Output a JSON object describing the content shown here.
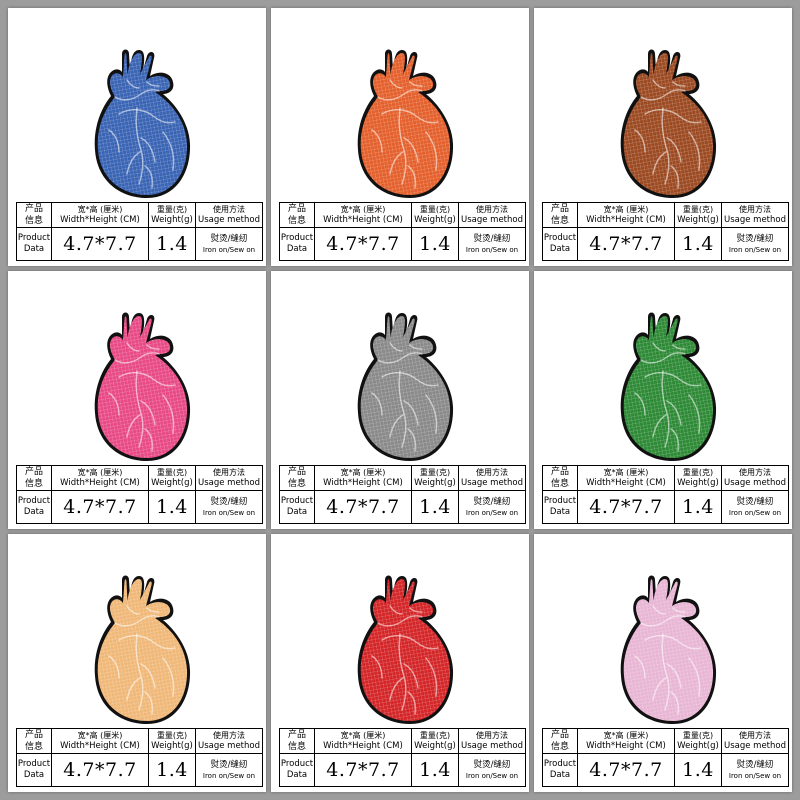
{
  "spec_table": {
    "product_data_cn_1": "产品",
    "product_data_cn_2": "信息",
    "product_data_en_1": "Product",
    "product_data_en_2": "Data",
    "size_header_cn": "宽*高 (厘米)",
    "size_header_en": "Width*Height (CM)",
    "weight_header_cn": "重量(克)",
    "weight_header_en": "Weight(g)",
    "usage_header_cn": "使用方法",
    "usage_header_en": "Usage method",
    "size_value": "4.7*7.7",
    "weight_value": "1.4",
    "usage_value_cn": "熨烫/缝纫",
    "usage_value_en": "Iron on/Sew on"
  },
  "variants": [
    {
      "color": "#3a64b4"
    },
    {
      "color": "#e4602c"
    },
    {
      "color": "#9c4a22"
    },
    {
      "color": "#e84a86"
    },
    {
      "color": "#8a8a8a"
    },
    {
      "color": "#2e8a36"
    },
    {
      "color": "#f0b878"
    },
    {
      "color": "#d42628"
    },
    {
      "color": "#e8b6d4"
    }
  ]
}
